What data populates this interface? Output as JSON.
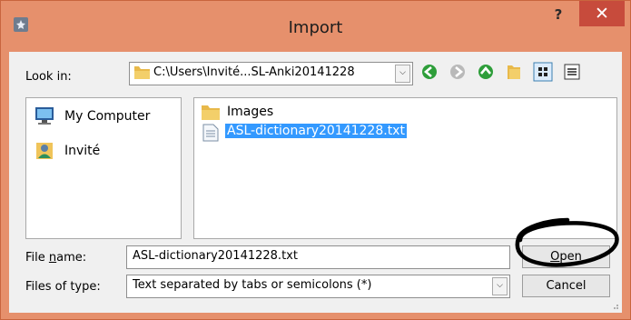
{
  "window": {
    "title": "Import",
    "help_label": "?",
    "close_label": "✕",
    "accent_color": "#e6906c",
    "close_color": "#c74b3c"
  },
  "lookin": {
    "label": "Look in:",
    "path": "C:\\Users\\Invité...SL-Anki20141228",
    "dropdown_arrow": "⌄"
  },
  "toolbar": {
    "back_icon": "back-arrow-icon",
    "forward_icon": "forward-arrow-icon",
    "up_icon": "up-arrow-icon",
    "new_folder_icon": "new-folder-icon",
    "list_view_icon": "list-view-icon",
    "detail_view_icon": "detail-view-icon"
  },
  "sidebar": {
    "items": [
      {
        "label": "My Computer",
        "icon": "computer-icon"
      },
      {
        "label": "Invité",
        "icon": "user-icon"
      }
    ]
  },
  "files": {
    "items": [
      {
        "label": "Images",
        "icon": "folder-icon",
        "selected": false
      },
      {
        "label": "ASL-dictionary20141228.txt",
        "icon": "text-file-icon",
        "selected": true
      }
    ]
  },
  "filename": {
    "label": "File name:",
    "label_underline": "n",
    "value": "ASL-dictionary20141228.txt"
  },
  "filetype": {
    "label": "Files of type:",
    "value": "Text separated by tabs or semicolons (*)"
  },
  "buttons": {
    "open": "Open",
    "cancel": "Cancel"
  }
}
